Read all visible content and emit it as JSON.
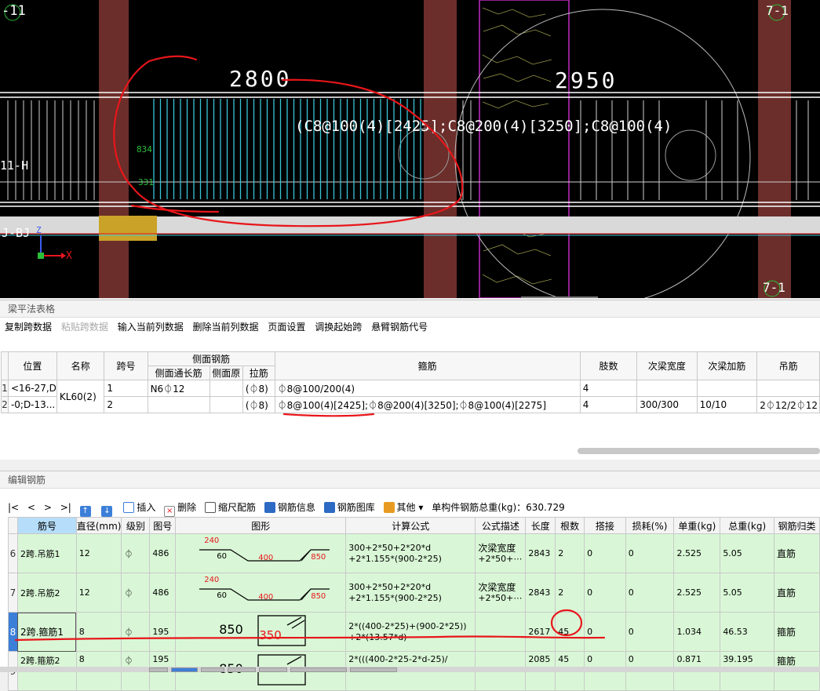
{
  "cad": {
    "axis_top_left": "-11",
    "axis_top_right": "7-1",
    "axis_bottom_right": "7-1",
    "axis_left_mid": "11-H",
    "axis_left_low": "J-BJ",
    "dim_left": "2800",
    "dim_right": "2950",
    "stirrup_label": "(C8@100(4)[2425];C8@200(4)[3250];C8@100(4)",
    "small_label_1": "834",
    "small_label_2": "331",
    "axis_z": "Z",
    "axis_x": "X"
  },
  "panel1": {
    "title": "梁平法表格",
    "toolbar": [
      {
        "label": "复制跨数据",
        "disabled": false
      },
      {
        "label": "粘贴跨数据",
        "disabled": true
      },
      {
        "label": "输入当前列数据",
        "disabled": false
      },
      {
        "label": "删除当前列数据",
        "disabled": false
      },
      {
        "label": "页面设置",
        "disabled": false
      },
      {
        "label": "调换起始跨",
        "disabled": false
      },
      {
        "label": "悬臂钢筋代号",
        "disabled": false
      }
    ],
    "headers": {
      "position": "位置",
      "name": "名称",
      "span": "跨号",
      "side_group": "侧面钢筋",
      "side_long": "侧面通长筋",
      "side_orig": "侧面原",
      "tie": "拉筋",
      "stirrup": "箍筋",
      "legs": "肢数",
      "sec_width": "次梁宽度",
      "sec_add": "次梁加筋",
      "hanger": "吊筋"
    },
    "rows": [
      {
        "idx": "1",
        "position": "<16-27,D",
        "name": "KL60(2)",
        "span": "1",
        "side_long": "N6⏀12",
        "side_orig": "",
        "tie": "(⏀8)",
        "stirrup": "⏀8@100/200(4)",
        "legs": "4",
        "sec_width": "",
        "sec_add": "",
        "hanger": ""
      },
      {
        "idx": "2",
        "position": "-0;D-13...",
        "name": "",
        "span": "2",
        "side_long": "",
        "side_orig": "",
        "tie": "(⏀8)",
        "stirrup": "⏀8@100(4)[2425];⏀8@200(4)[3250];⏀8@100(4)[2275]",
        "legs": "4",
        "sec_width": "300/300",
        "sec_add": "10/10",
        "hanger": "2⏀12/2⏀12"
      }
    ]
  },
  "panel2": {
    "title": "编辑钢筋",
    "nav": [
      "|<",
      "<",
      ">",
      ">|"
    ],
    "toolbar": {
      "insert": "插入",
      "delete": "删除",
      "scale": "缩尺配筋",
      "info": "钢筋信息",
      "library": "钢筋图库",
      "other": "其他",
      "total_label": "单构件钢筋总重(kg)：630.729"
    },
    "headers": [
      "筋号",
      "直径(mm)",
      "级别",
      "图号",
      "图形",
      "计算公式",
      "公式描述",
      "长度",
      "根数",
      "搭接",
      "损耗(%)",
      "单重(kg)",
      "总重(kg)",
      "钢筋归类"
    ],
    "rows": [
      {
        "idx": "6",
        "name": "2跨.吊筋1",
        "dia": "12",
        "grade": "⏀",
        "fig": "486",
        "f1": "300+2*50+2*20*d",
        "f2": "+2*1.155*(900-2*25)",
        "d1": "次梁宽度",
        "d2": "+2*50+⋯",
        "len": "2843",
        "count": "2",
        "lap": "0",
        "loss": "0",
        "unit": "2.525",
        "total": "5.05",
        "cls": "直筋",
        "shape": {
          "a": "240",
          "b": "60",
          "c": "400",
          "d": "850"
        }
      },
      {
        "idx": "7",
        "name": "2跨.吊筋2",
        "dia": "12",
        "grade": "⏀",
        "fig": "486",
        "f1": "300+2*50+2*20*d",
        "f2": "+2*1.155*(900-2*25)",
        "d1": "次梁宽度",
        "d2": "+2*50+⋯",
        "len": "2843",
        "count": "2",
        "lap": "0",
        "loss": "0",
        "unit": "2.525",
        "total": "5.05",
        "cls": "直筋",
        "shape": {
          "a": "240",
          "b": "60",
          "c": "400",
          "d": "850"
        }
      },
      {
        "idx": "8",
        "name": "2跨.箍筋1",
        "dia": "8",
        "grade": "⏀",
        "fig": "195",
        "f1": "2*((400-2*25)+(900-2*25))",
        "f2": "+2*(13.57*d)",
        "d1": "",
        "d2": "",
        "len": "2617",
        "count": "45",
        "lap": "0",
        "loss": "0",
        "unit": "1.034",
        "total": "46.53",
        "cls": "箍筋",
        "shape": {
          "h": "850",
          "w": "350"
        }
      },
      {
        "idx": "9",
        "name": "2跨.箍筋2",
        "dia": "8",
        "grade": "⏀",
        "fig": "195",
        "f1": "2*(((400-2*25-2*d-25)/",
        "f2": "",
        "d1": "",
        "d2": "",
        "len": "2085",
        "count": "45",
        "lap": "0",
        "loss": "0",
        "unit": "0.871",
        "total": "39.195",
        "cls": "箍筋",
        "shape": {
          "h": "850",
          "w": ""
        }
      }
    ]
  },
  "colors": {
    "cad_bg": "#000000",
    "column": "#6b2e2a",
    "stirrup_cyan": "#39c6d8",
    "annotation_red": "#e8161b",
    "row_green": "#d9f7d6",
    "selected_blue": "#3c7fd8"
  }
}
